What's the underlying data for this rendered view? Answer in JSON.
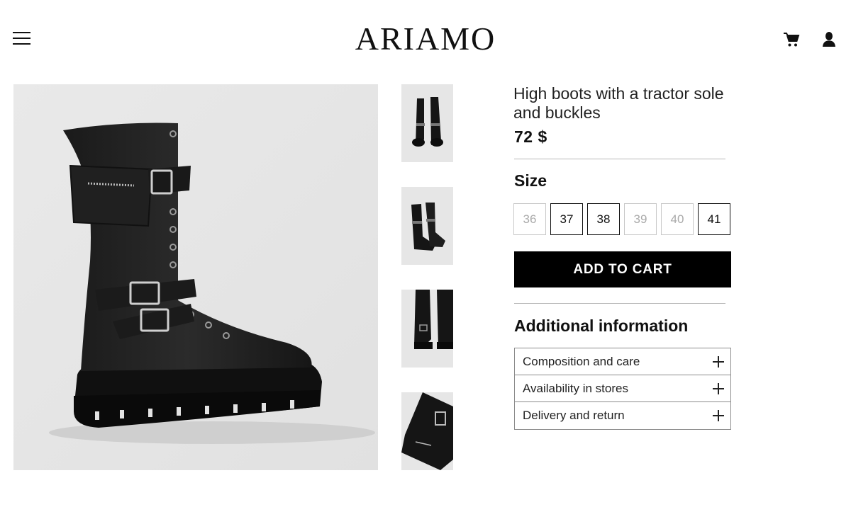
{
  "header": {
    "logo": "ARIAMO",
    "menu_icon": "hamburger-menu-icon",
    "cart_icon": "shopping-cart-icon",
    "user_icon": "user-account-icon"
  },
  "gallery": {
    "main_image": "black high lace-up boot with tractor sole, pocket and buckles",
    "thumbnails": [
      "pair of boots front view",
      "pair of boots angled view",
      "boots heel close-up",
      "boot pocket detail"
    ]
  },
  "product": {
    "title": "High boots with a tractor sole and buckles",
    "price": "72 $",
    "size_label": "Size",
    "sizes": [
      {
        "label": "36",
        "available": false
      },
      {
        "label": "37",
        "available": true
      },
      {
        "label": "38",
        "available": true
      },
      {
        "label": "39",
        "available": false
      },
      {
        "label": "40",
        "available": false
      },
      {
        "label": "41",
        "available": true
      }
    ],
    "add_to_cart": "ADD TO CART"
  },
  "additional": {
    "heading": "Additional information",
    "items": [
      {
        "label": "Composition and care"
      },
      {
        "label": "Availability in stores"
      },
      {
        "label": "Delivery and return"
      }
    ],
    "expand_icon": "plus-icon"
  },
  "colors": {
    "accent": "#000000",
    "image_bg": "#e6e6e6",
    "disabled": "#aaaaaa"
  }
}
